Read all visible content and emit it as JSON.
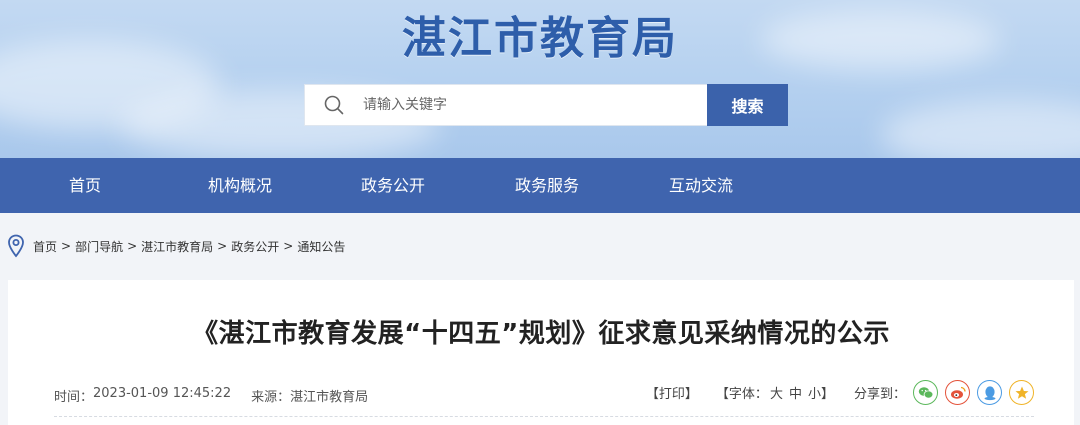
{
  "header": {
    "site_title": "湛江市教育局",
    "search": {
      "placeholder": "请输入关键字",
      "button_label": "搜索"
    }
  },
  "nav": {
    "items": [
      {
        "label": "首页"
      },
      {
        "label": "机构概况"
      },
      {
        "label": "政务公开"
      },
      {
        "label": "政务服务"
      },
      {
        "label": "互动交流"
      }
    ]
  },
  "breadcrumb": {
    "items": [
      "首页",
      "部门导航",
      "湛江市教育局",
      "政务公开",
      "通知公告"
    ],
    "separator": ">"
  },
  "article": {
    "title": "《湛江市教育发展“十四五”规划》征求意见采纳情况的公示",
    "time_label": "时间：",
    "time_value": "2023-01-09 12:45:22",
    "source_label": "来源：",
    "source_value": "湛江市教育局",
    "print_label": "【打印】",
    "font_label": "【字体：",
    "font_large": "大",
    "font_medium": "中",
    "font_small": "小】",
    "share_label": "分享到："
  },
  "share_icons": [
    {
      "name": "wechat-icon",
      "color": "#5cb85c"
    },
    {
      "name": "weibo-icon",
      "color": "#e4533b"
    },
    {
      "name": "qq-icon",
      "color": "#4b9be3"
    },
    {
      "name": "qzone-icon",
      "color": "#f0b429"
    }
  ],
  "colors": {
    "primary_blue": "#3f64ae",
    "search_button": "#3b62ab",
    "title_blue": "#2e5eaa"
  }
}
